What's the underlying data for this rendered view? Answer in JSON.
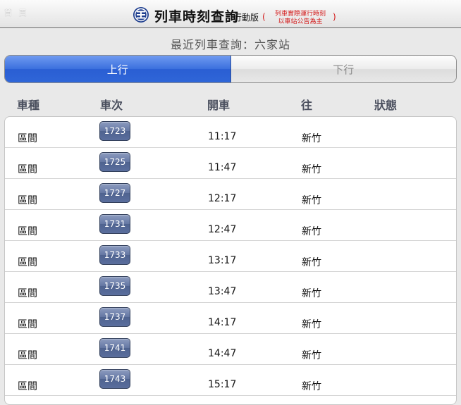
{
  "header": {
    "home_label": "首 頁",
    "title": "列車時刻查詢",
    "subtitle": "行動版",
    "notice_line1": "列車實際運行時刻",
    "notice_line2": "以車站公告為主",
    "notice_open": "(",
    "notice_close": ")"
  },
  "station_title": "最近列車查詢：六家站",
  "tabs": [
    {
      "label": "上行",
      "active": true
    },
    {
      "label": "下行",
      "active": false
    }
  ],
  "columns": [
    "車種",
    "車次",
    "開車",
    "往",
    "狀態"
  ],
  "rows": [
    {
      "type": "區間",
      "train": "1723",
      "time": "11:17",
      "dest": "新竹",
      "status": ""
    },
    {
      "type": "區間",
      "train": "1725",
      "time": "11:47",
      "dest": "新竹",
      "status": ""
    },
    {
      "type": "區間",
      "train": "1727",
      "time": "12:17",
      "dest": "新竹",
      "status": ""
    },
    {
      "type": "區間",
      "train": "1731",
      "time": "12:47",
      "dest": "新竹",
      "status": ""
    },
    {
      "type": "區間",
      "train": "1733",
      "time": "13:17",
      "dest": "新竹",
      "status": ""
    },
    {
      "type": "區間",
      "train": "1735",
      "time": "13:47",
      "dest": "新竹",
      "status": ""
    },
    {
      "type": "區間",
      "train": "1737",
      "time": "14:17",
      "dest": "新竹",
      "status": ""
    },
    {
      "type": "區間",
      "train": "1741",
      "time": "14:47",
      "dest": "新竹",
      "status": ""
    },
    {
      "type": "區間",
      "train": "1743",
      "time": "15:17",
      "dest": "新竹",
      "status": ""
    }
  ],
  "colors": {
    "accent_blue": "#3b70de",
    "train_button": "#5a6e9d",
    "notice_red": "#d21414"
  },
  "icons": {
    "logo": "tra-logo-icon"
  }
}
